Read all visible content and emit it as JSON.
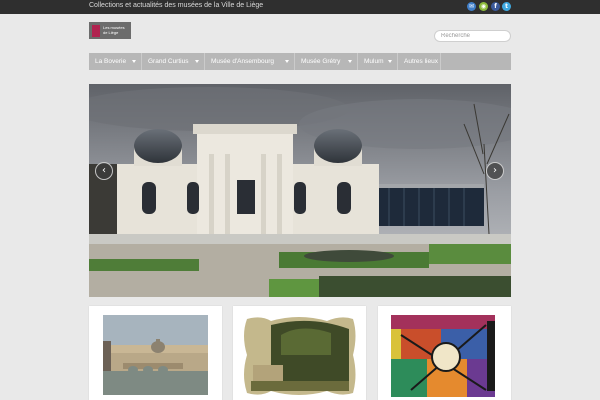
{
  "topbar": {
    "tagline": "Collections et actualités des musées de la Ville de Liège",
    "social": [
      {
        "icon": "email-icon",
        "glyph": "✉",
        "color": "#3f7ec9"
      },
      {
        "icon": "rss-icon",
        "glyph": "◉",
        "color": "#8dbb3c"
      },
      {
        "icon": "facebook-icon",
        "glyph": "f",
        "color": "#3b5a9a"
      },
      {
        "icon": "twitter-icon",
        "glyph": "t",
        "color": "#3fa9df"
      }
    ]
  },
  "logo": {
    "line1": "Les musées",
    "line2": "de Liège",
    "accent": "#b0234f"
  },
  "search": {
    "placeholder": "Recherche",
    "value": ""
  },
  "nav": {
    "items": [
      {
        "label": "La Boverie",
        "dropdown": true
      },
      {
        "label": "Grand Curtius",
        "dropdown": true
      },
      {
        "label": "Musée d'Ansembourg",
        "dropdown": true
      },
      {
        "label": "Musée Grétry",
        "dropdown": true
      },
      {
        "label": "Mulum",
        "dropdown": true
      },
      {
        "label": "Autres lieux",
        "dropdown": false
      }
    ]
  },
  "slider": {
    "prev_glyph": "‹",
    "next_glyph": "›"
  },
  "cards": [
    {
      "name": "card-rome-painting"
    },
    {
      "name": "card-landscape-painting"
    },
    {
      "name": "card-colorful-artwork"
    }
  ]
}
